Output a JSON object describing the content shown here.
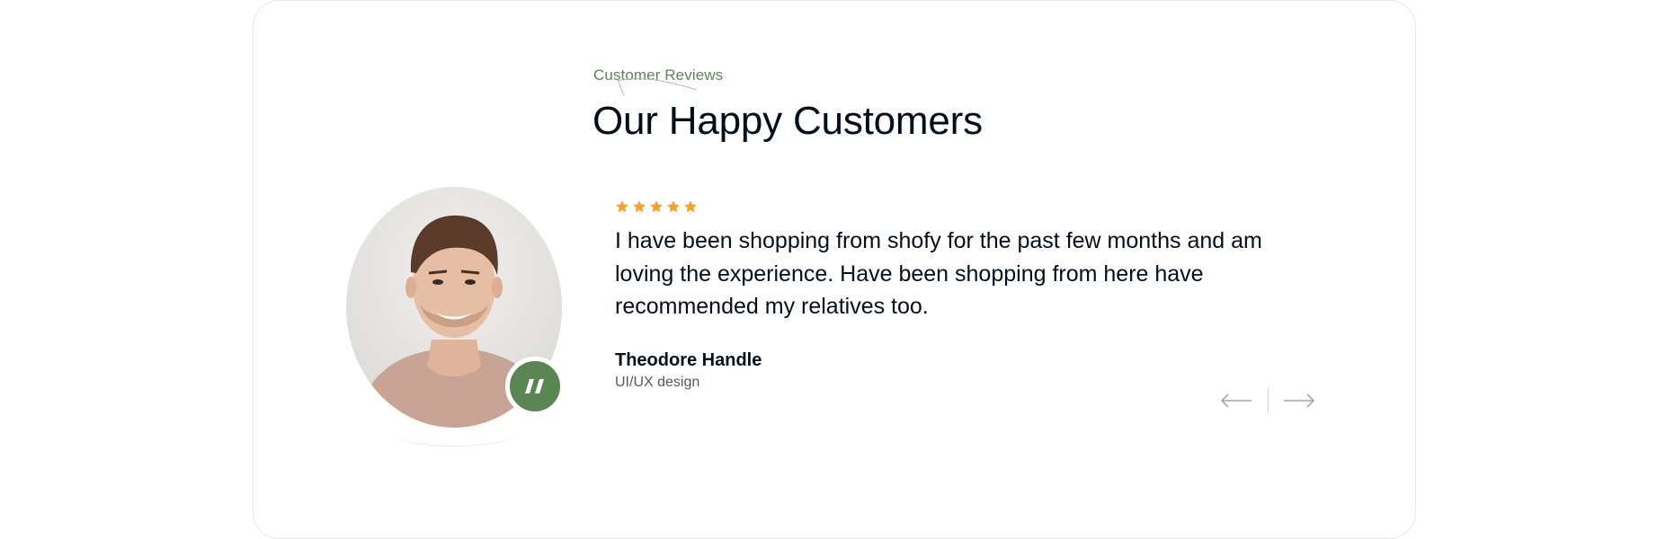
{
  "section": {
    "subtitle": "Customer Reviews",
    "title": "Our Happy Customers"
  },
  "review": {
    "rating": 5,
    "rating_max": 5,
    "text": "I have been shopping from shofy for the past few months and am loving the experience. Have been shopping from here have recommended my relatives too.",
    "author_name": "Theodore Handle",
    "author_role": "UI/UX design"
  },
  "icons": {
    "star": "star-icon",
    "quote": "quote-icon",
    "prev": "arrow-left-icon",
    "next": "arrow-right-icon"
  },
  "colors": {
    "accent_green": "#5a8653",
    "star_orange": "#f3a332",
    "heading": "#010f1c",
    "muted": "#55585b",
    "arrow": "#a0a3a6"
  }
}
